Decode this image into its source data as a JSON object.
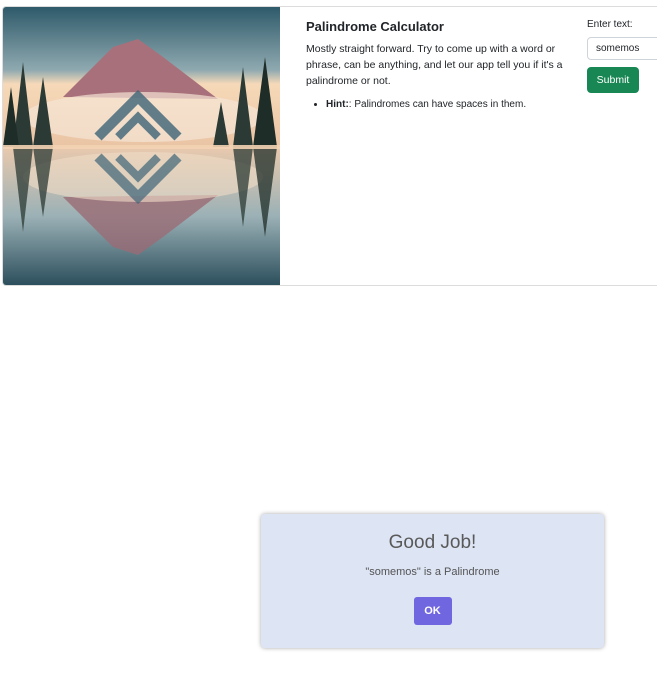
{
  "card": {
    "image_alt": "Mountain lake reflection with logo",
    "title": "Palindrome Calculator",
    "description": "Mostly straight forward. Try to come up with a word or phrase, can be anything, and let our app tell you if it's a palindrome or not.",
    "hint_label": "Hint:",
    "hint_text": ": Palindromes can have spaces in them."
  },
  "form": {
    "label": "Enter text:",
    "input_value": "somemos",
    "submit_label": "Submit"
  },
  "modal": {
    "title": "Good Job!",
    "message": "\"somemos\" is a Palindrome",
    "ok_label": "OK"
  },
  "colors": {
    "submit_bg": "#198754",
    "modal_bg": "#dde4f4",
    "ok_bg": "#7066e0"
  }
}
